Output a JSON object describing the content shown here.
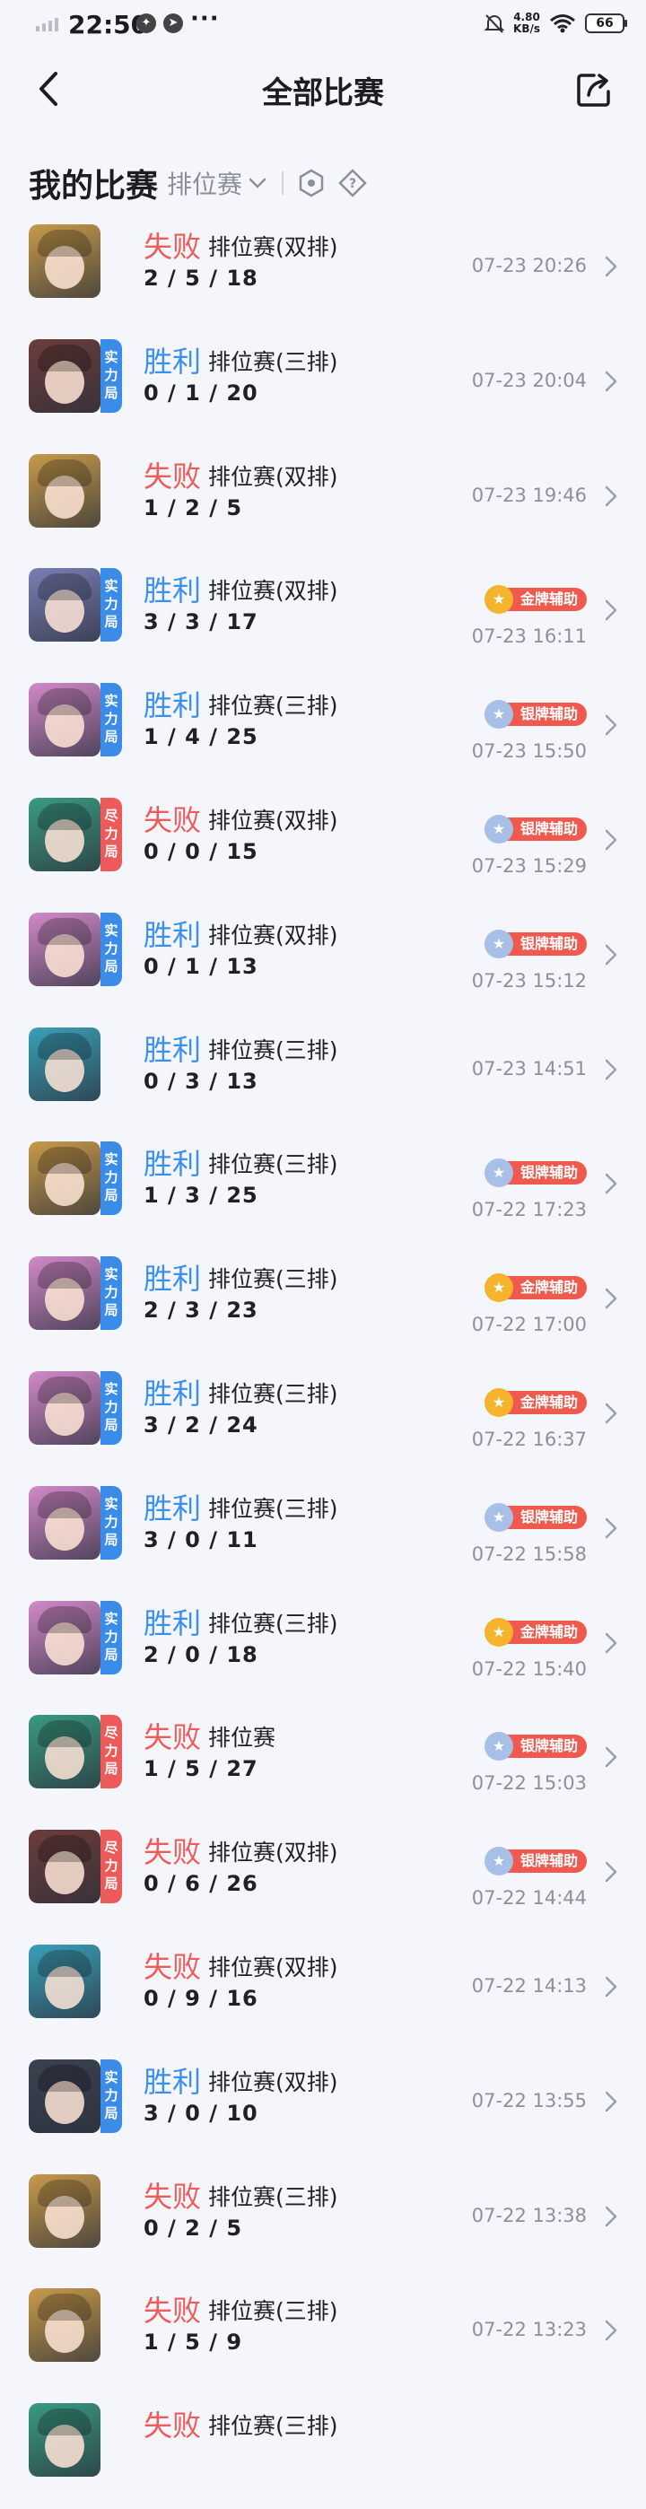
{
  "status_bar": {
    "time": "22:50",
    "more": "···",
    "net_speed_value": "4.80",
    "net_speed_unit": "KB/s",
    "battery": "66"
  },
  "header": {
    "title": "全部比赛"
  },
  "filter": {
    "title": "我的比赛",
    "mode": "排位赛"
  },
  "matches": [
    {
      "result": "失败",
      "type": "lose",
      "mode": "排位赛(双排)",
      "kda": "2 / 5 / 18",
      "time": "07-23 20:26",
      "tag": "",
      "badge": "",
      "hero_color": "#c89a4a"
    },
    {
      "result": "胜利",
      "type": "win",
      "mode": "排位赛(三排)",
      "kda": "0 / 1 / 20",
      "time": "07-23 20:04",
      "tag": "实力局",
      "tag_color": "blue",
      "badge": "",
      "hero_color": "#6b3d3a"
    },
    {
      "result": "失败",
      "type": "lose",
      "mode": "排位赛(双排)",
      "kda": "1 / 2 / 5",
      "time": "07-23 19:46",
      "tag": "",
      "badge": "",
      "hero_color": "#c89a4a"
    },
    {
      "result": "胜利",
      "type": "win",
      "mode": "排位赛(双排)",
      "kda": "3 / 3 / 17",
      "time": "07-23 16:11",
      "tag": "实力局",
      "tag_color": "blue",
      "badge": "金牌辅助",
      "badge_type": "gold",
      "hero_color": "#7a7fb5"
    },
    {
      "result": "胜利",
      "type": "win",
      "mode": "排位赛(三排)",
      "kda": "1 / 4 / 25",
      "time": "07-23 15:50",
      "tag": "实力局",
      "tag_color": "blue",
      "badge": "银牌辅助",
      "badge_type": "silver",
      "hero_color": "#d28ac9"
    },
    {
      "result": "失败",
      "type": "lose",
      "mode": "排位赛(双排)",
      "kda": "0 / 0 / 15",
      "time": "07-23 15:29",
      "tag": "尽力局",
      "tag_color": "red",
      "badge": "银牌辅助",
      "badge_type": "silver",
      "hero_color": "#3a9a82"
    },
    {
      "result": "胜利",
      "type": "win",
      "mode": "排位赛(双排)",
      "kda": "0 / 1 / 13",
      "time": "07-23 15:12",
      "tag": "实力局",
      "tag_color": "blue",
      "badge": "银牌辅助",
      "badge_type": "silver",
      "hero_color": "#d28ac9"
    },
    {
      "result": "胜利",
      "type": "win",
      "mode": "排位赛(三排)",
      "kda": "0 / 3 / 13",
      "time": "07-23 14:51",
      "tag": "",
      "badge": "",
      "hero_color": "#3aa0b8"
    },
    {
      "result": "胜利",
      "type": "win",
      "mode": "排位赛(三排)",
      "kda": "1 / 3 / 25",
      "time": "07-22 17:23",
      "tag": "实力局",
      "tag_color": "blue",
      "badge": "银牌辅助",
      "badge_type": "silver",
      "hero_color": "#c89a4a"
    },
    {
      "result": "胜利",
      "type": "win",
      "mode": "排位赛(三排)",
      "kda": "2 / 3 / 23",
      "time": "07-22 17:00",
      "tag": "实力局",
      "tag_color": "blue",
      "badge": "金牌辅助",
      "badge_type": "gold",
      "hero_color": "#d28ac9"
    },
    {
      "result": "胜利",
      "type": "win",
      "mode": "排位赛(三排)",
      "kda": "3 / 2 / 24",
      "time": "07-22 16:37",
      "tag": "实力局",
      "tag_color": "blue",
      "badge": "金牌辅助",
      "badge_type": "gold",
      "hero_color": "#d28ac9"
    },
    {
      "result": "胜利",
      "type": "win",
      "mode": "排位赛(三排)",
      "kda": "3 / 0 / 11",
      "time": "07-22 15:58",
      "tag": "实力局",
      "tag_color": "blue",
      "badge": "银牌辅助",
      "badge_type": "silver",
      "hero_color": "#d28ac9"
    },
    {
      "result": "胜利",
      "type": "win",
      "mode": "排位赛(三排)",
      "kda": "2 / 0 / 18",
      "time": "07-22 15:40",
      "tag": "实力局",
      "tag_color": "blue",
      "badge": "金牌辅助",
      "badge_type": "gold",
      "hero_color": "#d28ac9"
    },
    {
      "result": "失败",
      "type": "lose",
      "mode": "排位赛",
      "kda": "1 / 5 / 27",
      "time": "07-22 15:03",
      "tag": "尽力局",
      "tag_color": "red",
      "badge": "银牌辅助",
      "badge_type": "silver",
      "hero_color": "#3a9a82"
    },
    {
      "result": "失败",
      "type": "lose",
      "mode": "排位赛(双排)",
      "kda": "0 / 6 / 26",
      "time": "07-22 14:44",
      "tag": "尽力局",
      "tag_color": "red",
      "badge": "银牌辅助",
      "badge_type": "silver",
      "hero_color": "#6b3d3a"
    },
    {
      "result": "失败",
      "type": "lose",
      "mode": "排位赛(双排)",
      "kda": "0 / 9 / 16",
      "time": "07-22 14:13",
      "tag": "",
      "badge": "",
      "hero_color": "#3aa0b8"
    },
    {
      "result": "胜利",
      "type": "win",
      "mode": "排位赛(双排)",
      "kda": "3 / 0 / 10",
      "time": "07-22 13:55",
      "tag": "实力局",
      "tag_color": "blue",
      "badge": "",
      "hero_color": "#3a4150"
    },
    {
      "result": "失败",
      "type": "lose",
      "mode": "排位赛(三排)",
      "kda": "0 / 2 / 5",
      "time": "07-22 13:38",
      "tag": "",
      "badge": "",
      "hero_color": "#c89a4a"
    },
    {
      "result": "失败",
      "type": "lose",
      "mode": "排位赛(三排)",
      "kda": "1 / 5 / 9",
      "time": "07-22 13:23",
      "tag": "",
      "badge": "",
      "hero_color": "#c89a4a"
    },
    {
      "result": "失败",
      "type": "lose",
      "mode": "排位赛(三排)",
      "kda": "",
      "time": "",
      "tag": "",
      "badge": "",
      "hero_color": "#3a9a82"
    }
  ]
}
